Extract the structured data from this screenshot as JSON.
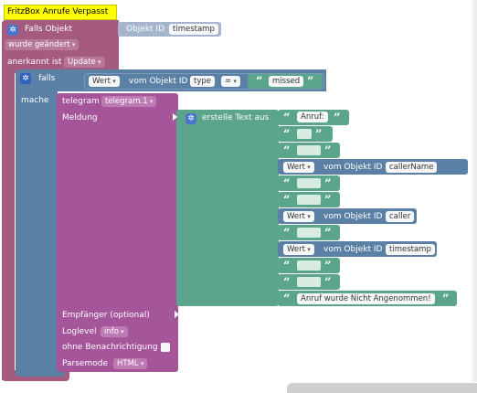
{
  "comment": "FritzBox Anrufe Verpasst",
  "trigger": {
    "falls_objekt": "Falls Objekt",
    "objekt_id_label": "Objekt ID",
    "objekt_id_value": "timestamp",
    "changed": "wurde geändert",
    "ack_label": "anerkannt ist",
    "ack_value": "Update"
  },
  "if_block": {
    "falls": "falls",
    "mache": "mache",
    "wert": "Wert",
    "vom_objekt_id": "vom Objekt ID",
    "type": "type",
    "op": "=",
    "missed": "missed"
  },
  "telegram": {
    "label": "telegram",
    "instance": "telegram.1",
    "meldung": "Meldung",
    "empfaenger": "Empfänger (optional)",
    "loglevel_label": "Loglevel",
    "loglevel_value": "info",
    "ohne": "ohne Benachrichtigung",
    "parsemode_label": "Parsemode",
    "parsemode_value": "HTML"
  },
  "text_join": {
    "title": "erstelle Text aus",
    "anruf": "Anruf:",
    "wert": "Wert",
    "vom_objekt_id": "vom Objekt ID",
    "caller_name": "callerName",
    "caller": "caller",
    "timestamp": "timestamp",
    "nicht_angenommen": "Anruf wurde Nicht Angenommen!"
  },
  "colors": {
    "event": "#a55b80",
    "logic": "#5b80a5",
    "telegram": "#a5559a",
    "text": "#5ba58c",
    "comment": "#ffff00"
  }
}
